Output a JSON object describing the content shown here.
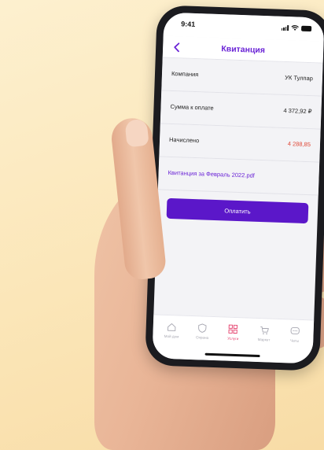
{
  "status": {
    "time": "9:41"
  },
  "navbar": {
    "title": "Квитанция"
  },
  "rows": [
    {
      "label": "Компания",
      "value": "УК Тулпар"
    },
    {
      "label": "Сумма к оплате",
      "value": "4 372,92 ₽"
    },
    {
      "label": "Начислено",
      "value": "4 288,85"
    }
  ],
  "receipt_link": "Квитанция за Февраль 2022.pdf",
  "pay_button": "Оплатить",
  "tabbar": {
    "items": [
      {
        "label": "Мой дом",
        "icon": "home-icon"
      },
      {
        "label": "Охрана",
        "icon": "shield-icon"
      },
      {
        "label": "Услуги",
        "icon": "grid-icon"
      },
      {
        "label": "Маркет",
        "icon": "cart-icon"
      },
      {
        "label": "Чаты",
        "icon": "chat-icon"
      }
    ],
    "active_index": 2
  },
  "colors": {
    "accent": "#5b17c9",
    "title": "#6a23d6",
    "charged_amount": "#e04a3a",
    "active_tab": "#e5436f",
    "background": "#fbe6b8"
  }
}
